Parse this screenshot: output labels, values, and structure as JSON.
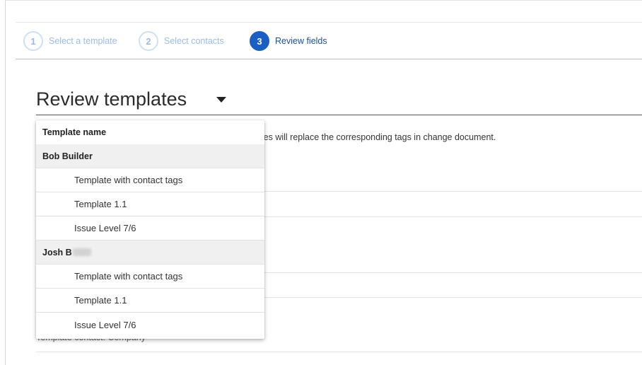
{
  "stepper": {
    "steps": [
      {
        "number": "1",
        "label": "Select a template"
      },
      {
        "number": "2",
        "label": "Select contacts"
      },
      {
        "number": "3",
        "label": "Review fields"
      }
    ],
    "active_step": 3
  },
  "page": {
    "title": "Review templates",
    "description_visible": "alues will replace the corresponding tags in change document.",
    "under_text": "Template contact: Company"
  },
  "dropdown": {
    "header": "Template name",
    "groups": [
      {
        "name": "Bob Builder",
        "items": [
          "Template with contact tags",
          "Template 1.1",
          "Issue Level 7/6"
        ]
      },
      {
        "name": "Josh B",
        "items": [
          "Template with contact tags",
          "Template 1.1",
          "Issue Level 7/6"
        ]
      }
    ]
  },
  "colors": {
    "accent": "#1a5fc4",
    "inactive_step": "#9cbbe3",
    "group_bg": "#f0f0f0"
  }
}
